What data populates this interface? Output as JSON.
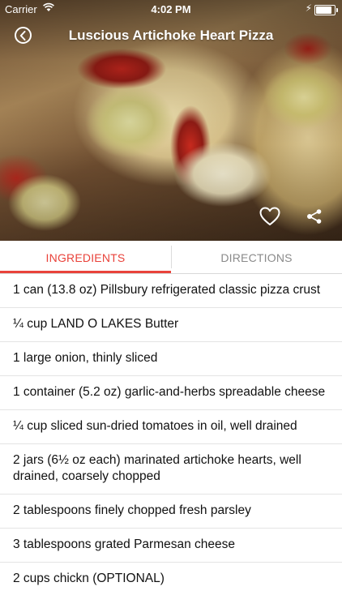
{
  "status_bar": {
    "carrier": "Carrier",
    "time": "4:02 PM"
  },
  "header": {
    "title": "Luscious Artichoke Heart Pizza"
  },
  "tabs": [
    {
      "label": "INGREDIENTS",
      "active": true
    },
    {
      "label": "DIRECTIONS",
      "active": false
    }
  ],
  "accent_color": "#e9423a",
  "ingredients": [
    "1 can (13.8 oz) Pillsbury refrigerated classic pizza crust",
    "¼ cup LAND O LAKES Butter",
    "1 large onion, thinly sliced",
    "1 container (5.2 oz) garlic-and-herbs spreadable cheese",
    "¼ cup sliced sun-dried tomatoes in oil, well drained",
    "2 jars (6½ oz each) marinated artichoke hearts, well drained, coarsely chopped",
    "2 tablespoons finely chopped fresh parsley",
    "3 tablespoons grated Parmesan cheese",
    "2 cups chickn (OPTIONAL)"
  ]
}
